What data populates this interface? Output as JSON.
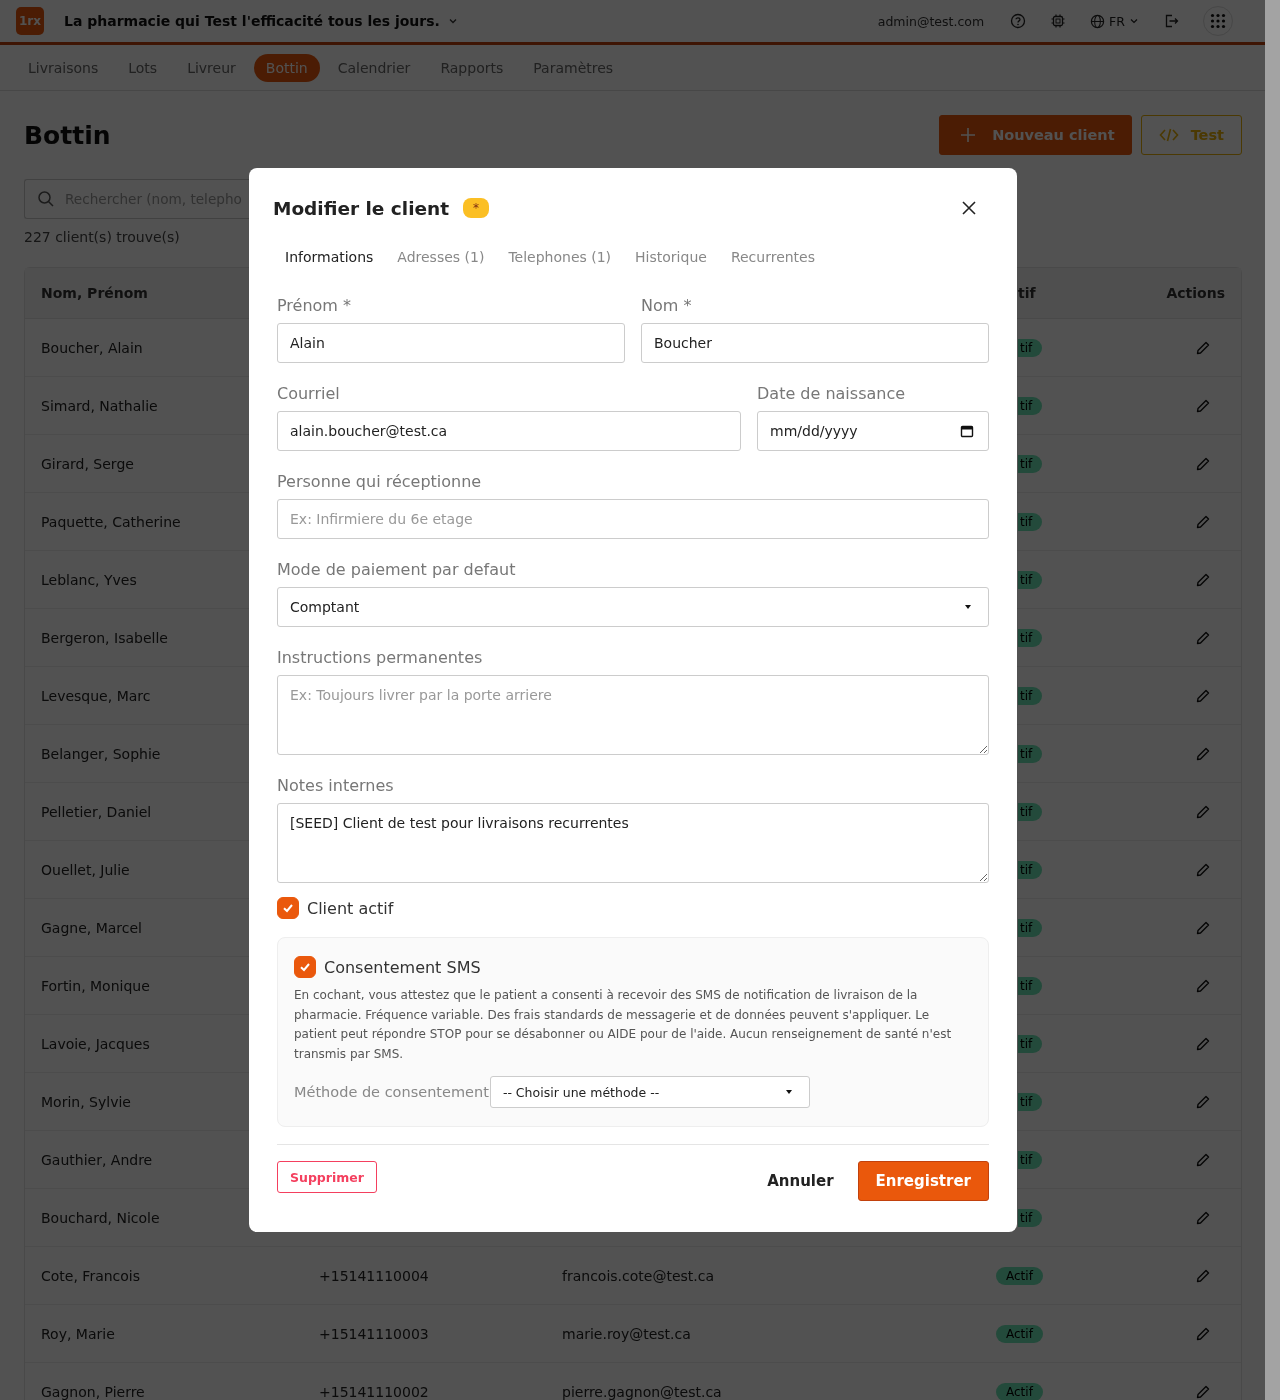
{
  "header": {
    "logo": "1rx",
    "pharmacy": "La pharmacie qui Test l'efficacité tous les jours.",
    "user": "admin@test.com",
    "language": "FR"
  },
  "nav": [
    {
      "label": "Livraisons",
      "selected": false
    },
    {
      "label": "Lots",
      "selected": false
    },
    {
      "label": "Livreur",
      "selected": false
    },
    {
      "label": "Bottin",
      "selected": true
    },
    {
      "label": "Calendrier",
      "selected": false
    },
    {
      "label": "Rapports",
      "selected": false
    },
    {
      "label": "Paramètres",
      "selected": false
    }
  ],
  "page": {
    "title": "Bottin",
    "buttons": [
      {
        "label": "Nouveau client",
        "kind": "primary"
      },
      {
        "label": "Test",
        "kind": "code"
      }
    ],
    "search": {
      "placeholder": "Rechercher (nom, telepho"
    },
    "count": "227 client(s) trouve(s)"
  },
  "table": {
    "columns": [
      "Nom, Prénom",
      "tif",
      "Actions"
    ],
    "rows": [
      {
        "name": "Boucher, Alain",
        "status": "tif"
      },
      {
        "name": "Simard, Nathalie",
        "status": "tif"
      },
      {
        "name": "Girard, Serge",
        "status": "tif"
      },
      {
        "name": "Paquette, Catherine",
        "status": "tif"
      },
      {
        "name": "Leblanc, Yves",
        "status": "tif"
      },
      {
        "name": "Bergeron, Isabelle",
        "status": "tif"
      },
      {
        "name": "Levesque, Marc",
        "status": "tif"
      },
      {
        "name": "Belanger, Sophie",
        "status": "tif"
      },
      {
        "name": "Pelletier, Daniel",
        "status": "tif"
      },
      {
        "name": "Ouellet, Julie",
        "status": "tif"
      },
      {
        "name": "Gagne, Marcel",
        "status": "tif"
      },
      {
        "name": "Fortin, Monique",
        "status": "tif"
      },
      {
        "name": "Lavoie, Jacques",
        "status": "tif"
      },
      {
        "name": "Morin, Sylvie",
        "status": "tif"
      },
      {
        "name": "Gauthier, Andre",
        "status": "tif"
      },
      {
        "name": "Bouchard, Nicole",
        "status": "tif"
      },
      {
        "name": "Cote, Francois",
        "phone": "+15141110004",
        "email": "francois.cote@test.ca",
        "status": "Actif"
      },
      {
        "name": "Roy, Marie",
        "phone": "+15141110003",
        "email": "marie.roy@test.ca",
        "status": "Actif"
      },
      {
        "name": "Gagnon, Pierre",
        "phone": "+15141110002",
        "email": "pierre.gagnon@test.ca",
        "status": "Actif"
      }
    ]
  },
  "modal": {
    "title": "Modifier le client",
    "badge": "*",
    "tabs": [
      {
        "label": "Informations",
        "selected": true
      },
      {
        "label": "Adresses (1)",
        "selected": false
      },
      {
        "label": "Telephones (1)",
        "selected": false
      },
      {
        "label": "Historique",
        "selected": false
      },
      {
        "label": "Recurrentes",
        "selected": false
      }
    ],
    "first_name": {
      "label": "Prénom *",
      "value": "Alain"
    },
    "last_name": {
      "label": "Nom *",
      "value": "Boucher"
    },
    "email": {
      "label": "Courriel",
      "value": "alain.boucher@test.ca"
    },
    "birth_date": {
      "label": "Date de naissance",
      "placeholder": "mm/dd/yyyy"
    },
    "recipient": {
      "label": "Personne qui réceptionne",
      "placeholder": "Ex: Infirmiere du 6e etage"
    },
    "payment": {
      "label": "Mode de paiement par defaut",
      "value": "Comptant"
    },
    "instructions": {
      "label": "Instructions permanentes",
      "placeholder": "Ex: Toujours livrer par la porte arriere"
    },
    "notes": {
      "label": "Notes internes",
      "value": "[SEED] Client de test pour livraisons recurrentes"
    },
    "active": {
      "label": "Client actif",
      "checked": true
    },
    "sms": {
      "label": "Consentement SMS",
      "checked": true,
      "text": "En cochant, vous attestez que le patient a consenti à recevoir des SMS de notification de livraison de la pharmacie. Fréquence variable. Des frais standards de messagerie et de données peuvent s'appliquer. Le patient peut répondre STOP pour se désabonner ou AIDE pour de l'aide. Aucun renseignement de santé n'est transmis par SMS.",
      "method_label": "Méthode de consentement",
      "method_value": "-- Choisir une méthode --"
    },
    "delete": "Supprimer",
    "cancel": "Annuler",
    "save": "Enregistrer"
  }
}
